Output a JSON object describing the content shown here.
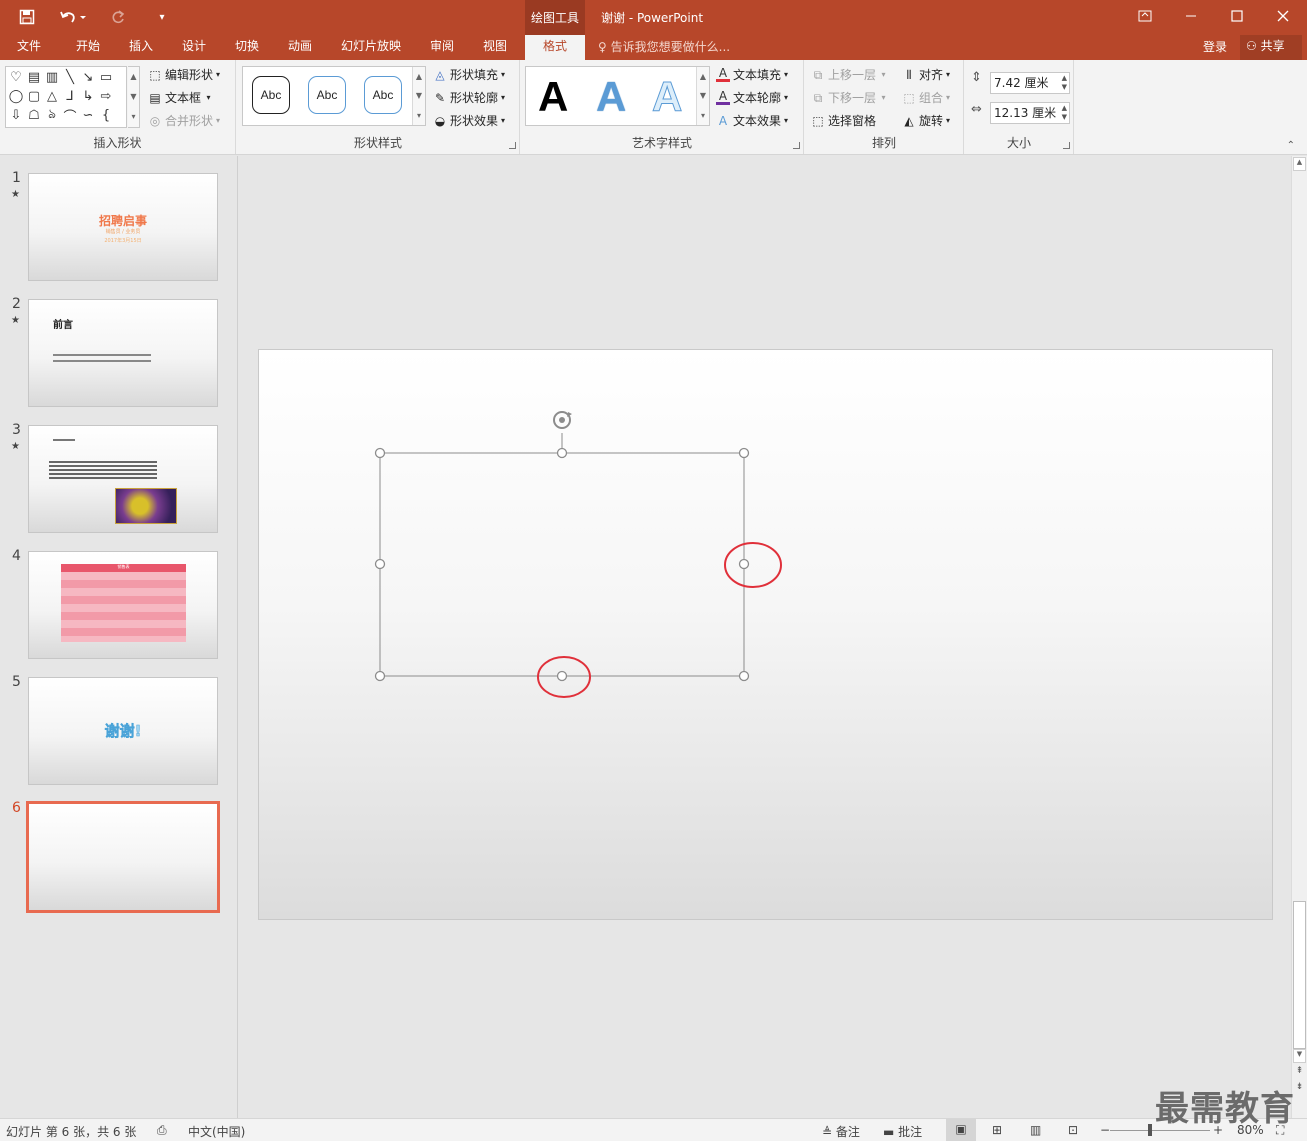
{
  "app": {
    "window_title": "谢谢 - PowerPoint",
    "context_tab_group": "绘图工具"
  },
  "quick_access": {
    "save_icon": "save-icon",
    "undo_icon": "undo-icon",
    "redo_icon": "redo-icon",
    "customize_icon": "customize-icon"
  },
  "window_controls": {
    "restore_ribbon": "ribbon-display-icon",
    "minimize": "minimize-icon",
    "maximize": "maximize-icon",
    "close": "close-icon"
  },
  "tabs": [
    {
      "label": "文件"
    },
    {
      "label": "开始"
    },
    {
      "label": "插入"
    },
    {
      "label": "设计"
    },
    {
      "label": "切换"
    },
    {
      "label": "动画"
    },
    {
      "label": "幻灯片放映"
    },
    {
      "label": "审阅"
    },
    {
      "label": "视图"
    },
    {
      "label": "格式",
      "active": true
    }
  ],
  "tell_me": "告诉我您想要做什么...",
  "account": {
    "signin": "登录",
    "share": "共享"
  },
  "ribbon": {
    "insert_shapes": {
      "label": "插入形状",
      "edit_shape": "编辑形状",
      "text_box": "文本框",
      "merge_shapes": "合并形状"
    },
    "shape_styles": {
      "label": "形状样式",
      "presets": [
        "Abc",
        "Abc",
        "Abc"
      ],
      "fill": "形状填充",
      "outline": "形状轮廓",
      "effects": "形状效果"
    },
    "wordart_styles": {
      "label": "艺术字样式",
      "samples": [
        "A",
        "A",
        "A"
      ],
      "text_fill": "文本填充",
      "text_outline": "文本轮廓",
      "text_effects": "文本效果"
    },
    "arrange": {
      "label": "排列",
      "bring_forward": "上移一层",
      "send_backward": "下移一层",
      "selection_pane": "选择窗格",
      "align": "对齐",
      "group": "组合",
      "rotate": "旋转"
    },
    "size": {
      "label": "大小",
      "height": "7.42 厘米",
      "width": "12.13 厘米"
    }
  },
  "slides": [
    {
      "number": "1",
      "star": "★",
      "title": "招聘启事",
      "subtitle": "销售员 / 业务员",
      "date": "2017年3月15日"
    },
    {
      "number": "2",
      "star": "★",
      "title": "前言"
    },
    {
      "number": "3",
      "star": "★"
    },
    {
      "number": "4",
      "table_title": "销售表"
    },
    {
      "number": "5",
      "text": "谢谢!"
    },
    {
      "number": "6",
      "selected": true
    }
  ],
  "status": {
    "slide_info": "幻灯片 第 6 张，共 6 张",
    "language": "中文(中国)",
    "notes": "备注",
    "comments": "批注",
    "zoom": "80%"
  },
  "watermark": "最需教育",
  "colors": {
    "accent": "#b7472a",
    "selection_border": "#e86a50",
    "annotation_circle": "#e0303a"
  }
}
